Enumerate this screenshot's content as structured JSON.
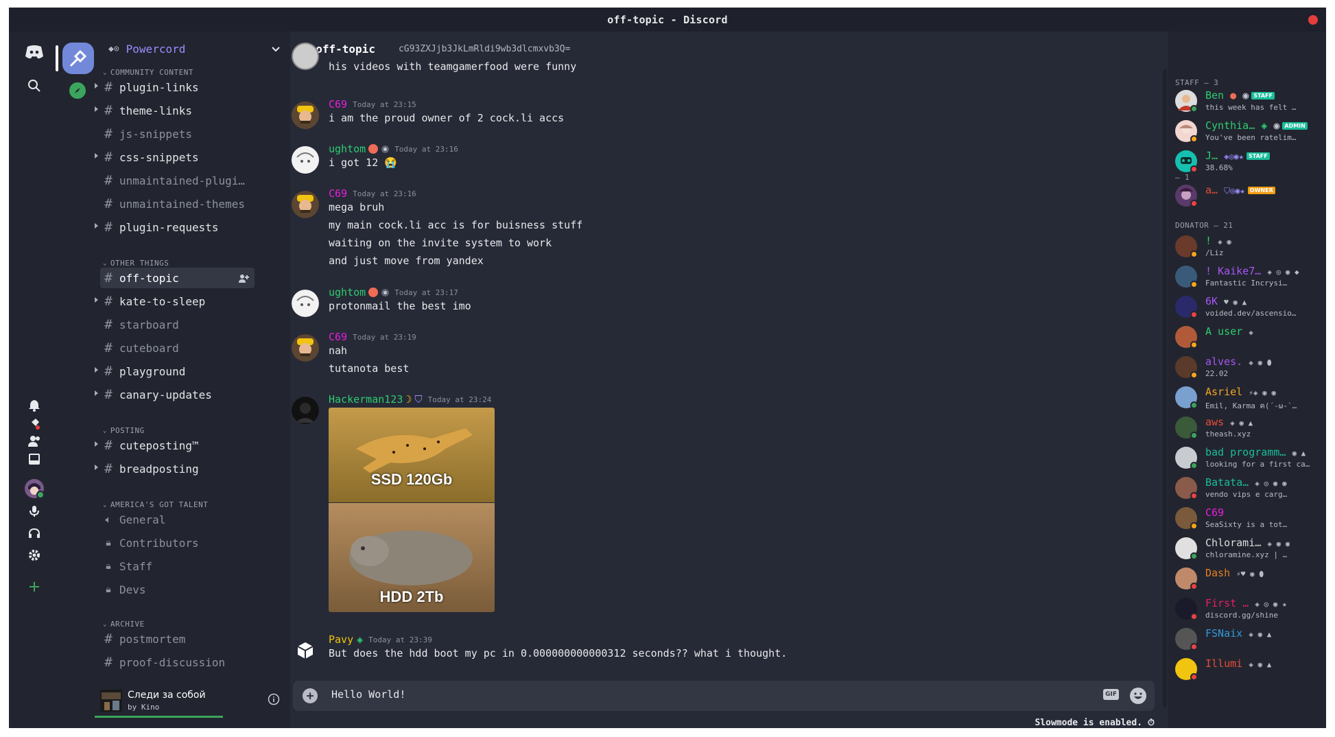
{
  "window": {
    "title": "off-topic - Discord"
  },
  "guild": {
    "name": "Powercord"
  },
  "channels": {
    "categories": {
      "community": "COMMUNITY CONTENT",
      "other": "OTHER THINGS",
      "posting": "POSTING",
      "agt": "AMERICA'S GOT TALENT",
      "archive": "ARCHIVE"
    },
    "community": [
      "plugin-links",
      "theme-links",
      "js-snippets",
      "css-snippets",
      "unmaintained-plugi…",
      "unmaintained-themes",
      "plugin-requests"
    ],
    "other": [
      "off-topic",
      "kate-to-sleep",
      "starboard",
      "cuteboard",
      "playground",
      "canary-updates"
    ],
    "posting": [
      "cuteposting™",
      "breadposting"
    ],
    "agt": [
      "General",
      "Contributors",
      "Staff",
      "Devs"
    ],
    "archive": [
      "postmortem",
      "proof-discussion"
    ]
  },
  "now_playing": {
    "title": "Следи за собой",
    "artist": "by Kino"
  },
  "chat": {
    "channel": "off-topic",
    "topic": "cG93ZXJjb3JkLmRldi9wb3dlcmxvb3Q=",
    "cut_line": "his videos with teamgamerfood were funny",
    "messages": [
      {
        "author": "C69",
        "time": "Today at 23:15",
        "lines": [
          "i am the proud owner of 2 cock.li accs"
        ]
      },
      {
        "author": "ughtom",
        "time": "Today at 23:16",
        "lines": [
          "i got 12 😭"
        ]
      },
      {
        "author": "C69",
        "time": "Today at 23:16",
        "lines": [
          "mega bruh",
          "my main cock.li acc is for buisness stuff",
          "waiting on the invite system to work",
          "and just move from yandex"
        ]
      },
      {
        "author": "ughtom",
        "time": "Today at 23:17",
        "lines": [
          "protonmail the best imo"
        ]
      },
      {
        "author": "C69",
        "time": "Today at 23:19",
        "lines": [
          "nah",
          "tutanota best"
        ]
      },
      {
        "author": "Hackerman123",
        "time": "Today at 23:24",
        "image_top": "SSD 120Gb",
        "image_bottom": "HDD 2Tb"
      },
      {
        "author": "Pavy",
        "time": "Today at 23:39",
        "lines": [
          "But does the hdd boot my pc in 0.000000000000312 seconds?? what i thought."
        ]
      }
    ],
    "composer_value": "Hello World!",
    "gif_label": "GIF",
    "slowmode": "Slowmode is enabled."
  },
  "members": {
    "groups": {
      "staff": "STAFF — 3",
      "one": "— 1",
      "donator": "DONATOR — 21"
    },
    "staff": [
      {
        "name": "Ben",
        "status": "this week has felt …",
        "tag": "STAFF",
        "color": "#2ecc71"
      },
      {
        "name": "Cynthia…",
        "status": "You've been ratelim…",
        "tag": "ADMIN",
        "color": "#2ecc71"
      },
      {
        "name": "J…",
        "status": "38.68%",
        "tag": "STAFF",
        "color": "#2ecc71"
      }
    ],
    "one": [
      {
        "name": "a…",
        "status": "",
        "tag": "OWNER",
        "color": "#e74c3c"
      }
    ],
    "donators": [
      {
        "name": "!",
        "status": "/Liz",
        "color": "#2ecc71"
      },
      {
        "name": "! Kaike7…",
        "status": "Fantastic Incrysi…",
        "color": "#a855f7"
      },
      {
        "name": "6K",
        "status": "voided.dev/ascensio…",
        "color": "#a855f7"
      },
      {
        "name": "A user",
        "status": "",
        "color": "#2ecc71"
      },
      {
        "name": "alves.",
        "status": "22.02",
        "color": "#a855f7"
      },
      {
        "name": "Asriel",
        "status": "Emil, Karma ฅ(´-ω-`…",
        "color": "#f5a623"
      },
      {
        "name": "aws",
        "status": "theash.xyz",
        "color": "#e74c3c"
      },
      {
        "name": "bad programm…",
        "status": "looking for a first ca…",
        "color": "#1abc9c"
      },
      {
        "name": "Batata…",
        "status": "vendo vips e carg…",
        "color": "#1abc9c"
      },
      {
        "name": "C69",
        "status": "SeaSixty is a tot…",
        "color": "#e91ee0"
      },
      {
        "name": "Chlorami…",
        "status": "chloramine.xyz | …",
        "color": "#dcddde"
      },
      {
        "name": "Dash",
        "status": "",
        "color": "#e67e22"
      },
      {
        "name": "First …",
        "status": "discord.gg/shine",
        "color": "#e91e63"
      },
      {
        "name": "FSNaix",
        "status": "",
        "color": "#3498db"
      },
      {
        "name": "Illumi",
        "status": "",
        "color": "#e74c3c"
      }
    ]
  },
  "colors": {
    "c69": "#e91ee0",
    "ughtom": "#2ecc71",
    "hackerman": "#2ecc71",
    "pavy": "#f1c40f",
    "accent": "#9b8cff"
  }
}
